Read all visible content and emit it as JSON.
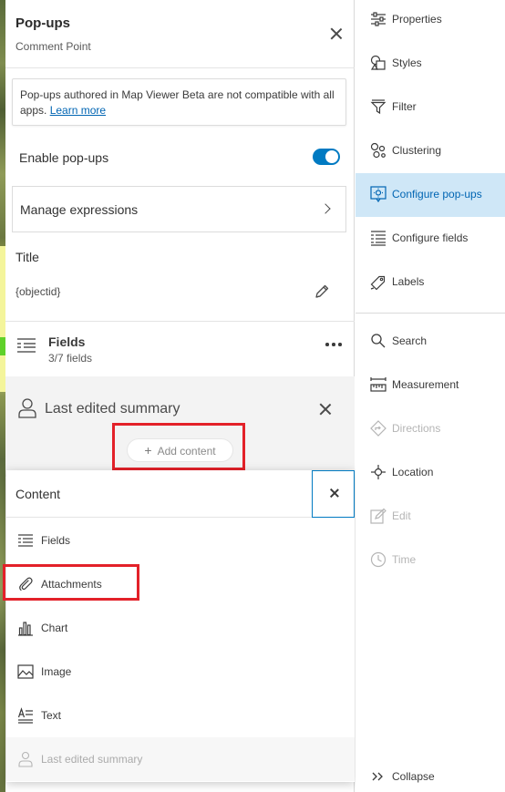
{
  "panel": {
    "title": "Pop-ups",
    "subtitle": "Comment Point",
    "notice_text": "Pop-ups authored in Map Viewer Beta are not compatible with all apps. ",
    "notice_link": "Learn more",
    "enable_label": "Enable pop-ups",
    "enable_on": true,
    "manage_label": "Manage expressions",
    "title_label": "Title",
    "title_value": "{objectid}",
    "fields_title": "Fields",
    "fields_sub": "3/7 fields",
    "summary_title": "Last edited summary",
    "add_content": "Add content"
  },
  "popover": {
    "title": "Content",
    "items": [
      {
        "label": "Fields",
        "icon": "fields-icon",
        "disabled": false
      },
      {
        "label": "Attachments",
        "icon": "attachment-icon",
        "disabled": false
      },
      {
        "label": "Chart",
        "icon": "chart-icon",
        "disabled": false
      },
      {
        "label": "Image",
        "icon": "image-icon",
        "disabled": false
      },
      {
        "label": "Text",
        "icon": "text-icon",
        "disabled": false
      },
      {
        "label": "Last edited summary",
        "icon": "person-icon",
        "disabled": true
      }
    ]
  },
  "action_bar": {
    "items": [
      {
        "label": "Properties",
        "icon": "sliders-icon"
      },
      {
        "label": "Styles",
        "icon": "styles-icon"
      },
      {
        "label": "Filter",
        "icon": "filter-icon"
      },
      {
        "label": "Clustering",
        "icon": "clustering-icon"
      },
      {
        "label": "Configure pop-ups",
        "icon": "popup-icon",
        "active": true
      },
      {
        "label": "Configure fields",
        "icon": "fields-icon"
      },
      {
        "label": "Labels",
        "icon": "label-icon"
      },
      {
        "label": "Search",
        "icon": "search-icon"
      },
      {
        "label": "Measurement",
        "icon": "measure-icon"
      },
      {
        "label": "Directions",
        "icon": "directions-icon",
        "disabled": true
      },
      {
        "label": "Location",
        "icon": "location-icon"
      },
      {
        "label": "Edit",
        "icon": "edit-icon",
        "disabled": true
      },
      {
        "label": "Time",
        "icon": "clock-icon",
        "disabled": true
      },
      {
        "label": "Collapse",
        "icon": "collapse-icon"
      }
    ]
  },
  "colors": {
    "accent": "#007ac2",
    "active_bg": "#cfe7f7",
    "highlight_red": "#e32129"
  }
}
